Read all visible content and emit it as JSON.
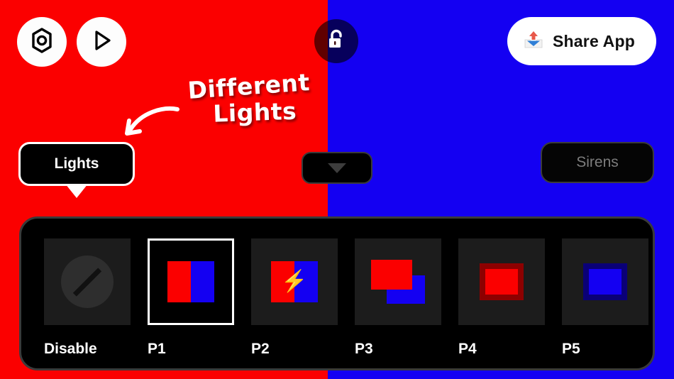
{
  "theme": {
    "red": "#fb0000",
    "blue": "#1400f2",
    "panel_bg": "#000000",
    "panel_border": "#3a3a3a",
    "thumb_bg": "#1c1c1c",
    "selected_border": "#ffffff",
    "inactive_text": "#7d7d7d"
  },
  "toolbar": {
    "settings_icon": "gear-nut-icon",
    "play_icon": "play-icon",
    "lock_icon": "unlocked-padlock-icon",
    "share": {
      "label": "Share App",
      "icon": "outbox-tray-icon"
    }
  },
  "annotation": {
    "line1": "Different",
    "line2": "Lights",
    "arrow_icon": "curved-arrow-icon"
  },
  "modes": {
    "lights": {
      "label": "Lights",
      "active": true
    },
    "dropdown": {
      "icon": "chevron-down-icon"
    },
    "sirens": {
      "label": "Sirens",
      "active": false
    }
  },
  "presets": {
    "selected": "P1",
    "items": [
      {
        "label": "Disable",
        "art": "slash-circle",
        "selected": false
      },
      {
        "label": "P1",
        "art": "split-red-blue",
        "selected": true
      },
      {
        "label": "P2",
        "art": "split-red-blue-bolt",
        "selected": false
      },
      {
        "label": "P3",
        "art": "offset-red-blue",
        "selected": false
      },
      {
        "label": "P4",
        "art": "ring-red",
        "selected": false
      },
      {
        "label": "P5",
        "art": "ring-blue",
        "selected": false
      }
    ]
  }
}
